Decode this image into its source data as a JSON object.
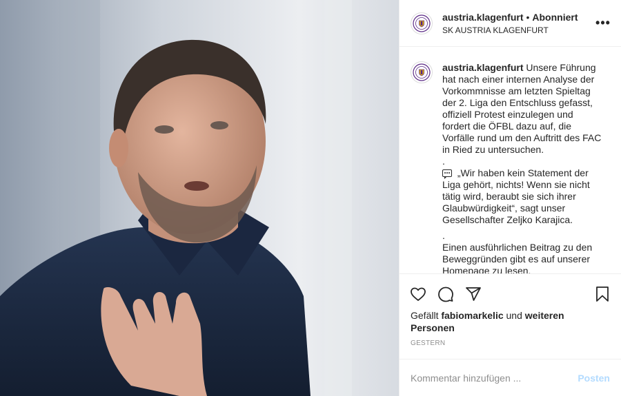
{
  "account": {
    "username": "austria.klagenfurt",
    "separator": "•",
    "follow_status": "Abonniert",
    "subtitle": "SK AUSTRIA KLAGENFURT"
  },
  "icons": {
    "more": "more-options-icon",
    "like": "heart-icon",
    "comment": "comment-icon",
    "share": "share-icon",
    "save": "bookmark-icon"
  },
  "caption": {
    "username": "austria.klagenfurt",
    "paragraph1": "Unsere Führung hat nach einer internen Analyse der Vorkommnisse am letzten Spieltag der 2. Liga den Entschluss gefasst, offiziell Protest einzulegen und fordert die ÖFBL dazu auf, die Vorfälle rund um den Auftritt des FAC in Ried zu untersuchen.",
    "dot1": ".",
    "quote": " „Wir haben kein Statement der Liga gehört, nichts! Wenn sie nicht tätig wird, beraubt sie sich ihrer Glaubwürdigkeit“, sagt unser Gesellschafter Zeljko Karajica.",
    "dot2": ".",
    "paragraph3": "Einen ausführlichen Beitrag zu den Beweggründen gibt es auf unserer Homepage zu lesen.",
    "dot3": ".",
    "dot4": "."
  },
  "likes": {
    "prefix": "Gefällt",
    "user": "fabiomarkelic",
    "middle": "und",
    "others": "weiteren Personen"
  },
  "date": "GESTERN",
  "comment": {
    "placeholder": "Kommentar hinzufügen ...",
    "post_label": "Posten"
  },
  "colors": {
    "text": "#262626",
    "muted": "#8e8e8e",
    "border": "#efefef",
    "post_disabled": "#b3dbff",
    "badge_purple": "#5b2a86"
  }
}
